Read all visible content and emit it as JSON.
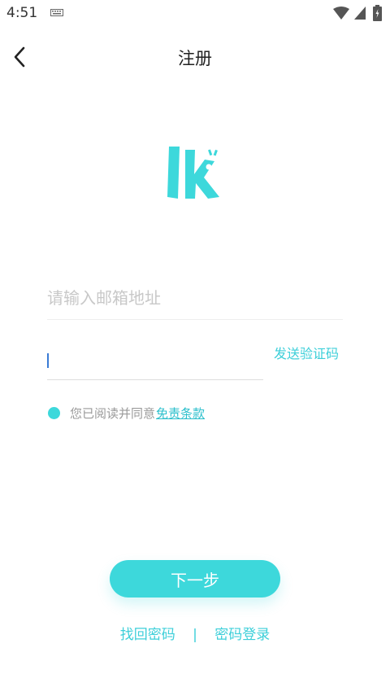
{
  "status_bar": {
    "time": "4:51"
  },
  "header": {
    "title": "注册"
  },
  "form": {
    "email_placeholder": "请输入邮箱地址",
    "code_value": "",
    "send_code_label": "发送验证码",
    "agree_text": "您已阅读并同意",
    "terms_link": "免责条款"
  },
  "actions": {
    "next_label": "下一步",
    "forgot_password": "找回密码",
    "divider": "|",
    "password_login": "密码登录"
  },
  "colors": {
    "accent": "#3dd8db",
    "link": "#2bbfcc",
    "cursor": "#3a7bd5"
  },
  "icons": [
    "keyboard-icon",
    "wifi-icon",
    "signal-icon",
    "battery-icon",
    "back-arrow-icon",
    "app-logo-icon"
  ]
}
